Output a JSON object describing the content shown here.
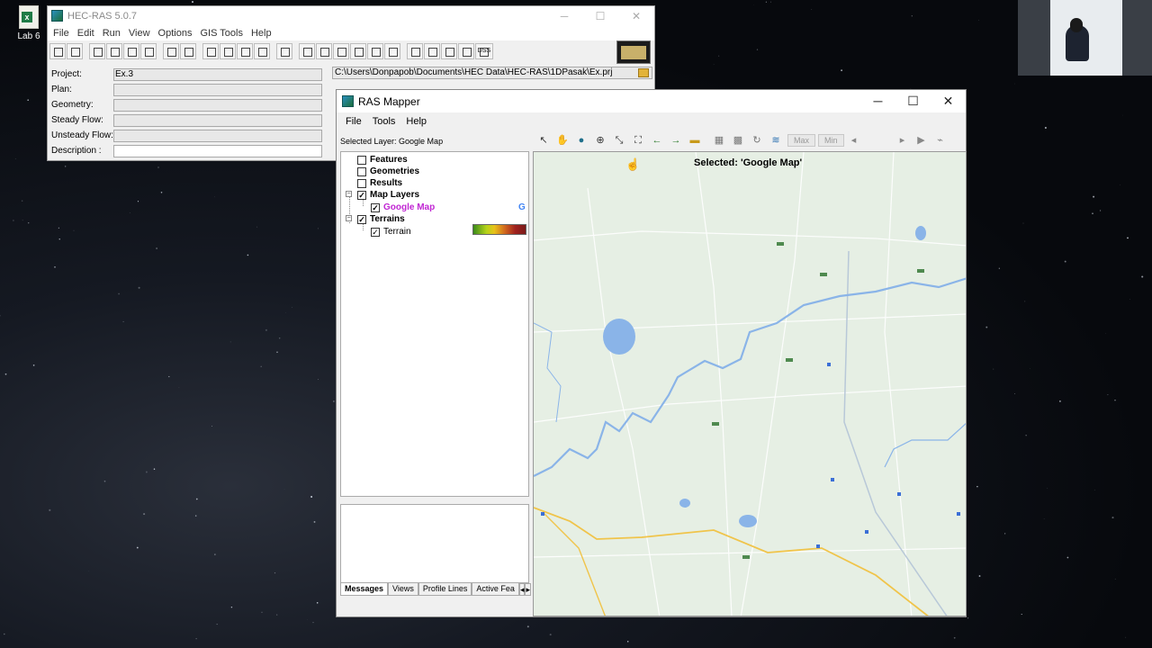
{
  "desktop": {
    "icon_label": "Lab 6"
  },
  "hecras": {
    "title": "HEC-RAS 5.0.7",
    "menu": [
      "File",
      "Edit",
      "Run",
      "View",
      "Options",
      "GIS Tools",
      "Help"
    ],
    "dss_label": "DSS",
    "fields": {
      "project_label": "Project:",
      "project_value": "Ex.3",
      "project_path": "C:\\Users\\Donpapob\\Documents\\HEC Data\\HEC-RAS\\1DPasak\\Ex.prj",
      "plan_label": "Plan:",
      "geometry_label": "Geometry:",
      "steady_label": "Steady Flow:",
      "unsteady_label": "Unsteady Flow:",
      "description_label": "Description :"
    }
  },
  "mapper": {
    "title": "RAS Mapper",
    "menu": [
      "File",
      "Tools",
      "Help"
    ],
    "selected_layer": "Selected Layer: Google Map",
    "max_label": "Max",
    "min_label": "Min",
    "map_selected": "Selected: 'Google Map'",
    "tree": {
      "features": "Features",
      "geometries": "Geometries",
      "results": "Results",
      "map_layers": "Map Layers",
      "google_map": "Google Map",
      "terrains": "Terrains",
      "terrain": "Terrain"
    },
    "tabs": [
      "Messages",
      "Views",
      "Profile Lines",
      "Active Fea"
    ]
  }
}
